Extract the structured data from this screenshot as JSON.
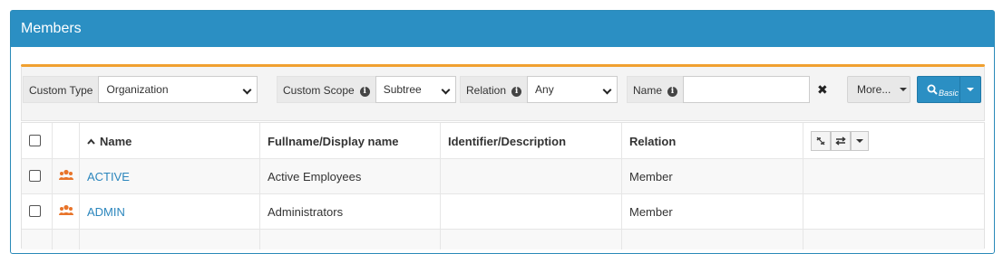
{
  "panel": {
    "title": "Members"
  },
  "filters": {
    "custom_type": {
      "label": "Custom Type",
      "value": "Organization"
    },
    "custom_scope": {
      "label": "Custom Scope",
      "value": "Subtree"
    },
    "relation": {
      "label": "Relation",
      "value": "Any"
    },
    "name": {
      "label": "Name",
      "value": ""
    },
    "clear_symbol": "✖",
    "more_label": "More...",
    "search_mode": "Basic"
  },
  "table": {
    "headers": {
      "name": "Name",
      "fullname": "Fullname/Display name",
      "identifier": "Identifier/Description",
      "relation": "Relation"
    },
    "rows": [
      {
        "name": "ACTIVE",
        "fullname": "Active Employees",
        "identifier": "",
        "relation": "Member"
      },
      {
        "name": "ADMIN",
        "fullname": "Administrators",
        "identifier": "",
        "relation": "Member"
      }
    ]
  },
  "colors": {
    "header_bg": "#2b8fc3",
    "accent_orange": "#f0a030",
    "link": "#2b86bd",
    "org_icon": "#e8742a"
  }
}
